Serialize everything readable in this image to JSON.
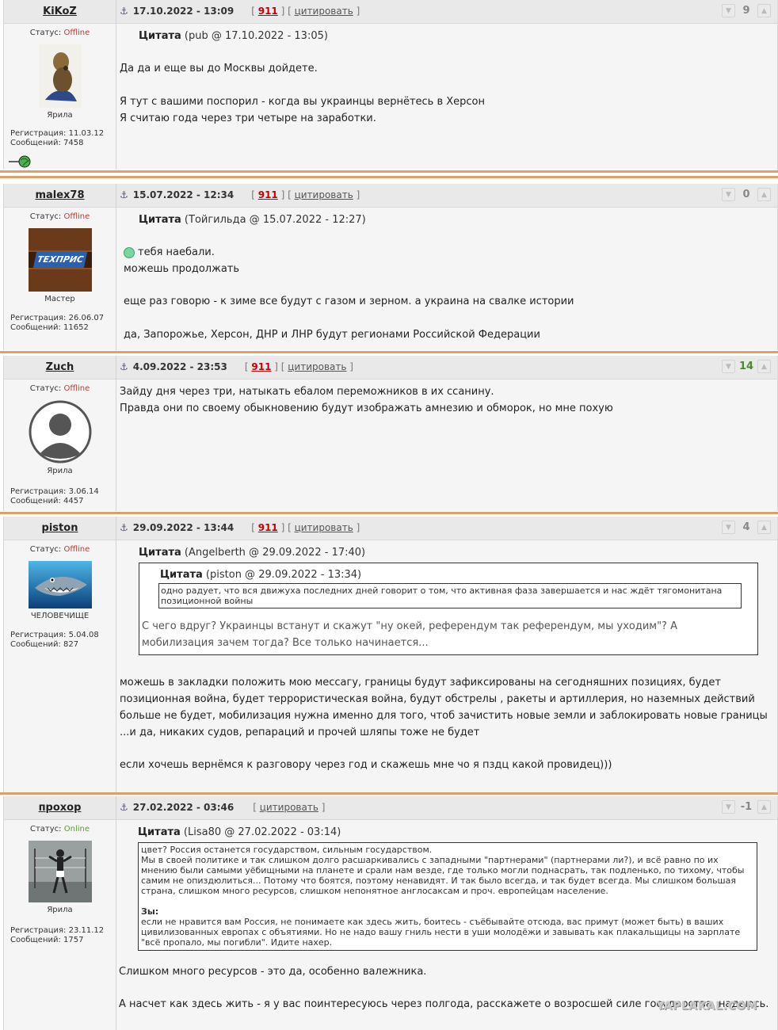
{
  "posts": [
    {
      "author": "KiKoZ",
      "date": "17.10.2022 - 13:09",
      "link_num": "911",
      "cite": "цитировать",
      "rating": "9",
      "status_label": "Статус:",
      "status": "Offline",
      "rank": "Ярила",
      "reg": "Регистрация: 11.03.12",
      "msgs": "Сообщений: 7458",
      "quote_word": "Цитата",
      "quote_src": " (pub @ 17.10.2022 - 13:05)",
      "lines": [
        "Да да и еще вы до Москвы дойдете.",
        "Я тут с вашими поспорил - когда вы украинцы вернётесь в Херсон",
        "Я считаю года через три четыре на заработки."
      ]
    },
    {
      "author": "malex78",
      "date": "15.07.2022 - 12:34",
      "link_num": "911",
      "cite": "цитировать",
      "rating": "0",
      "status_label": "Статус:",
      "status": "Offline",
      "rank": "Мастер",
      "avatar_text": "ТЕХПРИС",
      "reg": "Регистрация: 26.06.07",
      "msgs": "Сообщений: 11652",
      "quote_word": "Цитата",
      "quote_src": " (Тойгильда @ 15.07.2022 - 12:27)",
      "lines": [
        "тебя наебали.",
        "можешь продолжать",
        "еще раз говорю - к зиме все будут с газом и зерном. а украина на свалке истории",
        "да, Запорожье, Херсон, ДНР и ЛНР будут регионами Российской Федерации"
      ]
    },
    {
      "author": "Zuch",
      "date": "4.09.2022 - 23:53",
      "link_num": "911",
      "cite": "цитировать",
      "rating": "14",
      "status_label": "Статус:",
      "status": "Offline",
      "rank": "Ярила",
      "reg": "Регистрация: 3.06.14",
      "msgs": "Сообщений: 4457",
      "lines": [
        "Зайду дня через три, натыкать ебалом переможников в их ссанину.",
        "Правда они по своему обыкновению будут изображать амнезию и обморок, но мне похую"
      ]
    },
    {
      "author": "piston",
      "date": "29.09.2022 - 13:44",
      "link_num": "911",
      "cite": "цитировать",
      "rating": "4",
      "status_label": "Статус:",
      "status": "Offline",
      "rank": "ЧЕЛОВЕЧИЩЕ",
      "reg": "Регистрация: 5.04.08",
      "msgs": "Сообщений: 827",
      "quote_word": "Цитата",
      "quote_src": " (Angelberth @ 29.09.2022 - 17:40)",
      "inner_quote_src": " (piston @ 29.09.2022 - 13:34)",
      "inner_quote_text": "одно радует, что вся движуха последних дней говорит о том, что активная фаза завершается и нас ждёт тягомонитана позиционной войны",
      "quote_text": "С чего вдруг? Украинцы встанут и скажут \"ну окей, референдум так референдум, мы уходим\"? А мобилизация зачем тогда? Все только начинается...",
      "lines": [
        "можешь в закладки положить мою мессагу, границы будут зафиксированы на сегодняшних позициях, будет позиционная война, будет террористическая война, будут обстрелы , ракеты и артиллерия, но наземных действий больше не будет, мобилизация нужна именно для того, чтоб зачистить новые земли и заблокировать новые границы",
        "...и да, никаких судов, репараций и прочей шляпы тоже не будет",
        "если хочешь вернёмся к разговору через год и скажешь мне чо я пздц какой провидец)))"
      ]
    },
    {
      "author": "прохор",
      "date": "27.02.2022 - 03:46",
      "cite": "цитировать",
      "rating": "-1",
      "status_label": "Статус:",
      "status": "Online",
      "rank": "Ярила",
      "reg": "Регистрация: 23.11.12",
      "msgs": "Сообщений: 1757",
      "quote_word": "Цитата",
      "quote_src": " (Lisa80 @ 27.02.2022 - 03:14)",
      "quote_p1": "цвет? Россия останется государством, сильным государством.",
      "quote_p2": "Мы в своей политике и так слишком долго расшаркивались с западными \"партнерами\" (партнерами ли?), и всё равно по их мнению были самыми уёбищными на планете и срали нам везде, где только могли поднасрать, так подленько, по тихому, чтобы самим не опиздюлиться... Потому что боятся, поэтому ненавидят. И так было всегда, и так будет всегда. Мы слишком большая страна, слишком много ресурсов, слишком непонятное англосаксам и проч. европейцам население.",
      "quote_label": "Зы:",
      "quote_p3": "если не нравится вам Россия, не понимаете как здесь жить, боитесь - съёбывайте отсюда, вас примут (может быть) в ваших цивилизованных европах с объятиями. Но не надо вашу гниль нести в уши молодёжи и завывать как плакальщицы на зарплате \"всё пропало, мы погибли\". Идите нахер.",
      "lines": [
        "Слишком много ресурсов - это да, особенно валежника.",
        "А насчет как здесь жить - я у вас поинтересуюсь через полгода, расскажете о возросшей силе государства, надеюсь."
      ]
    }
  ],
  "watermark": "YAPLAKAL.COM"
}
